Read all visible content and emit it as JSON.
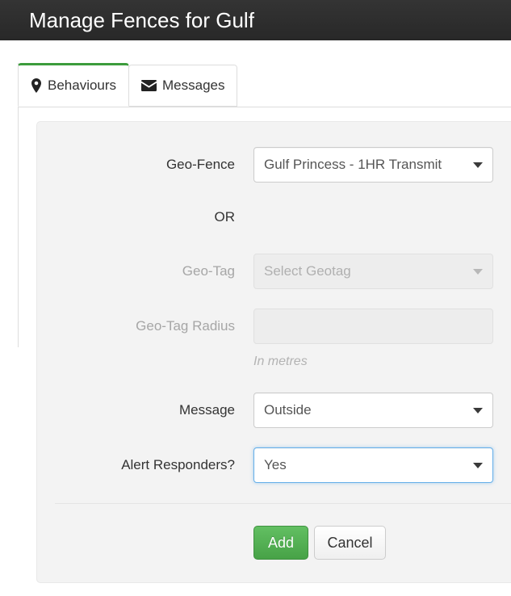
{
  "header": {
    "title": "Manage Fences for Gulf"
  },
  "tabs": [
    {
      "label": "Behaviours",
      "icon": "map-pin-icon",
      "active": true
    },
    {
      "label": "Messages",
      "icon": "envelope-icon",
      "active": false
    }
  ],
  "form": {
    "or_label": "OR",
    "fields": [
      {
        "key": "geo_fence",
        "label": "Geo-Fence",
        "control": "select",
        "value": "Gulf Princess - 1HR Transmit",
        "disabled": false,
        "focused": false
      },
      {
        "key": "geo_tag",
        "label": "Geo-Tag",
        "control": "select",
        "value": "Select Geotag",
        "disabled": true,
        "focused": false
      },
      {
        "key": "geo_tag_radius",
        "label": "Geo-Tag Radius",
        "control": "text",
        "value": "",
        "placeholder": "",
        "disabled": true,
        "focused": false,
        "help": "In metres"
      },
      {
        "key": "message",
        "label": "Message",
        "control": "select",
        "value": "Outside",
        "disabled": false,
        "focused": false
      },
      {
        "key": "alert_responders",
        "label": "Alert Responders?",
        "control": "select",
        "value": "Yes",
        "disabled": false,
        "focused": true
      }
    ]
  },
  "buttons": {
    "add": "Add",
    "cancel": "Cancel"
  },
  "colors": {
    "header_bg": "#2e2e2e",
    "active_tab_accent": "#3c9c3c",
    "panel_bg": "#f3f3f3",
    "add_button": "#5cb85c",
    "focus_border": "#66afe9"
  }
}
